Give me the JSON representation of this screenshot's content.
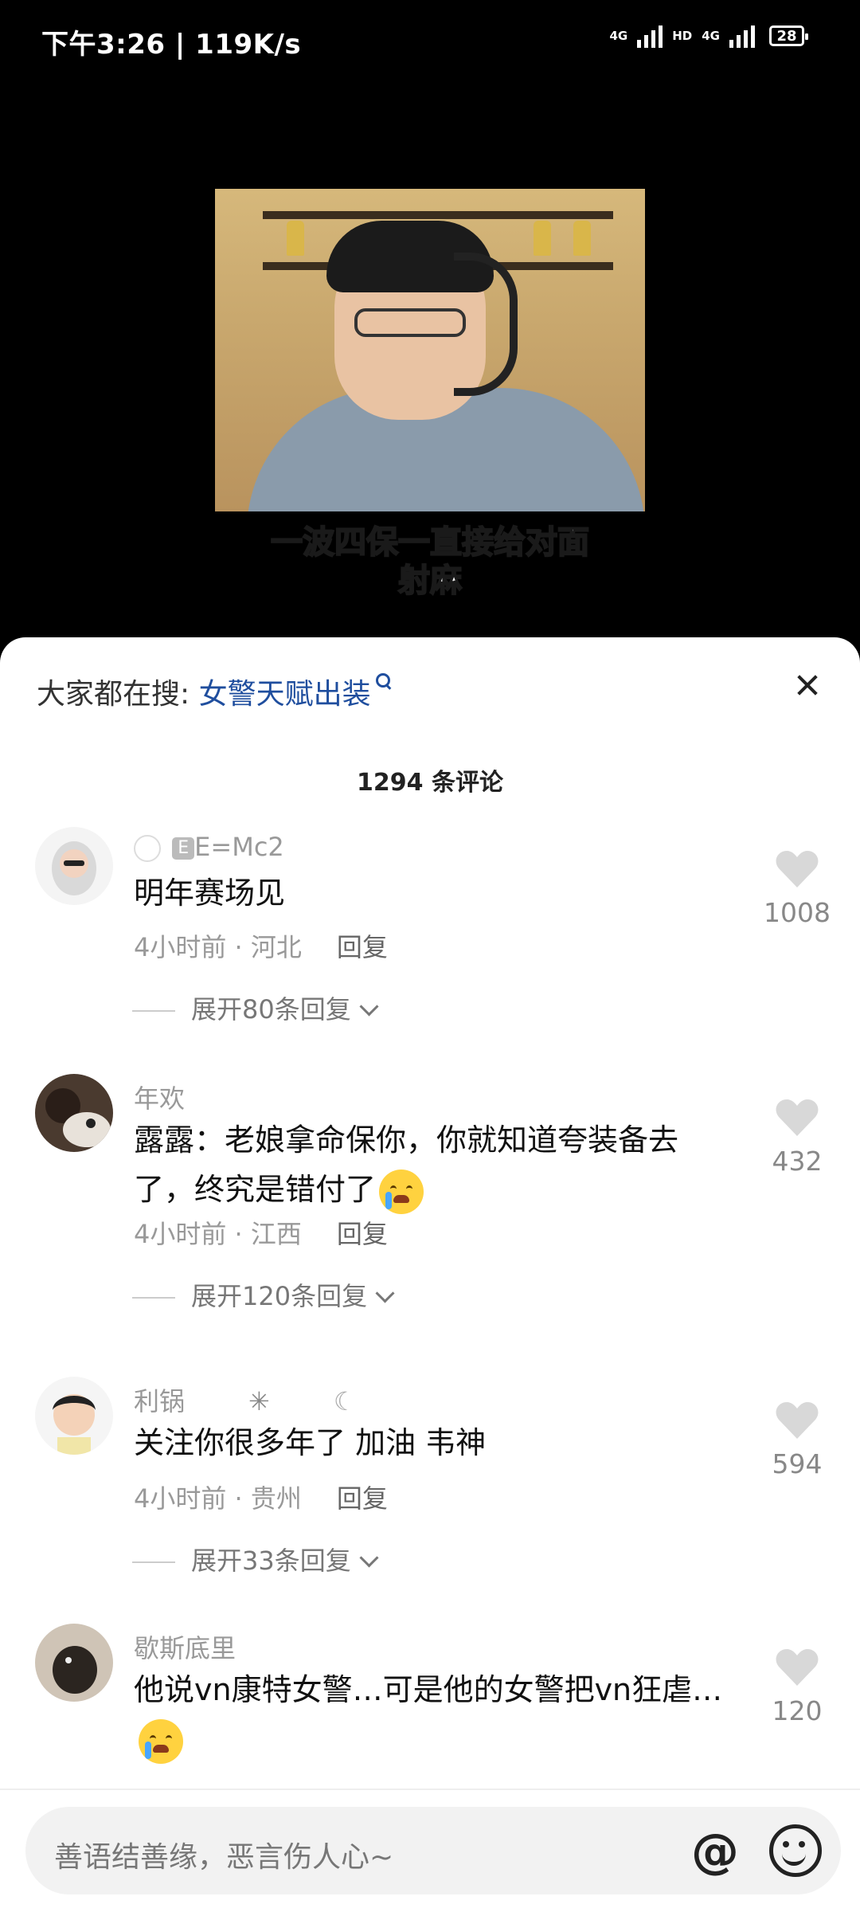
{
  "status_bar": {
    "time": "下午3:26 | 119K/s",
    "signal_1": "4G",
    "signal_2": "4G",
    "hd_label": "HD",
    "battery": "28"
  },
  "video": {
    "subtitle_line1": "一波四保一直接给对面",
    "subtitle_line2": "射麻"
  },
  "sheet": {
    "search_prefix": "大家都在搜:",
    "search_term": "女警天赋出装",
    "comment_count": "1294 条评论"
  },
  "comments": [
    {
      "username": "E=Mc2",
      "text": "明年赛场见",
      "time": "4小时前",
      "location": "河北",
      "reply": "回复",
      "expand": "展开80条回复",
      "likes": "1008"
    },
    {
      "username": "年欢",
      "text": "露露：老娘拿命保你，你就知道夸装备去了，终究是错付了",
      "time": "4小时前",
      "location": "江西",
      "reply": "回复",
      "expand": "展开120条回复",
      "likes": "432"
    },
    {
      "username": "利锅",
      "text": "关注你很多年了 加油 韦神",
      "time": "4小时前",
      "location": "贵州",
      "reply": "回复",
      "expand": "展开33条回复",
      "likes": "594"
    },
    {
      "username": "歇斯底里",
      "text": "他说vn康特女警…可是他的女警把vn狂虐…",
      "likes": "120"
    }
  ],
  "input": {
    "placeholder": "善语结善缘，恶言伤人心~"
  },
  "colors": {
    "accent": "#1f4e9e",
    "sheet_bg": "#ffffff",
    "muted": "#999999"
  }
}
